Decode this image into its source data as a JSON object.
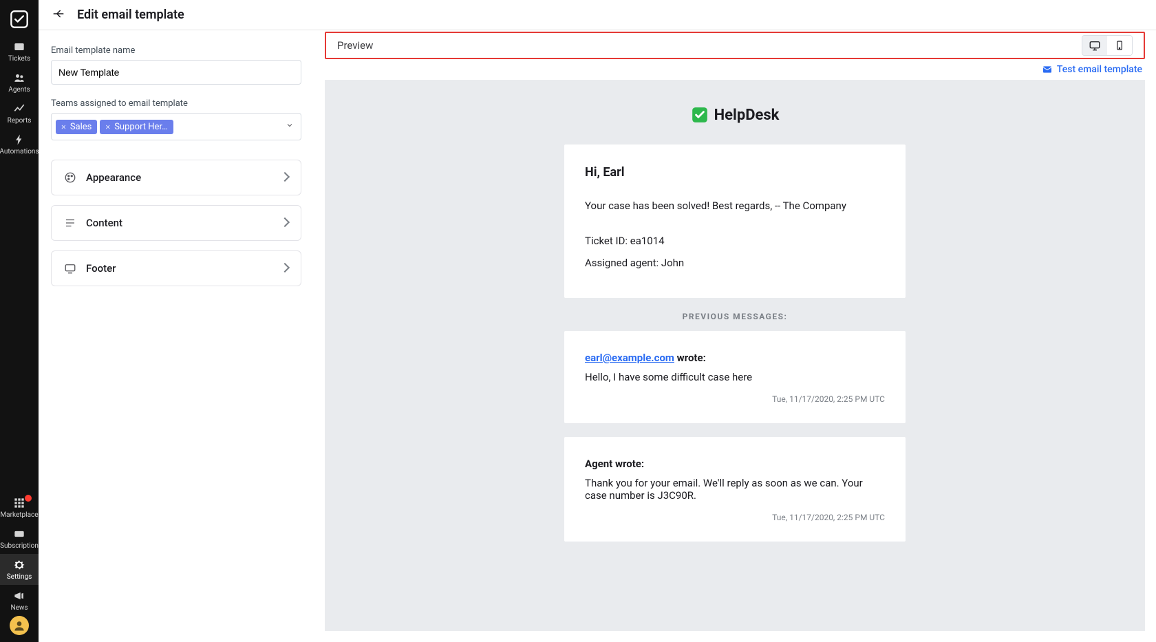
{
  "page": {
    "title": "Edit email template"
  },
  "sidebar": {
    "items": [
      {
        "label": "Tickets"
      },
      {
        "label": "Agents"
      },
      {
        "label": "Reports"
      },
      {
        "label": "Automations"
      }
    ],
    "bottom": [
      {
        "label": "Marketplace"
      },
      {
        "label": "Subscription"
      },
      {
        "label": "Settings"
      },
      {
        "label": "News"
      }
    ]
  },
  "form": {
    "name_label": "Email template name",
    "name_value": "New Template",
    "teams_label": "Teams assigned to email template",
    "team_chips": [
      "Sales",
      "Support Her…"
    ],
    "sections": {
      "appearance": "Appearance",
      "content": "Content",
      "footer": "Footer"
    }
  },
  "preview": {
    "title": "Preview",
    "test_link": "Test email template",
    "brand": "HelpDesk",
    "greeting": "Hi, Earl",
    "body": "Your case has been solved! Best regards, -- The Company",
    "meta_ticket": "Ticket ID: ea1014",
    "meta_agent": "Assigned agent: John",
    "prev_label": "PREVIOUS MESSAGES:",
    "messages": [
      {
        "author_link": "earl@example.com",
        "author_suffix": " wrote:",
        "body": "Hello, I have some difficult case here",
        "time": "Tue, 11/17/2020, 2:25 PM UTC"
      },
      {
        "author_text": "Agent wrote:",
        "body": "Thank you for your email. We'll reply as soon as we can. Your case number is J3C90R.",
        "time": "Tue, 11/17/2020, 2:25 PM UTC"
      }
    ]
  }
}
